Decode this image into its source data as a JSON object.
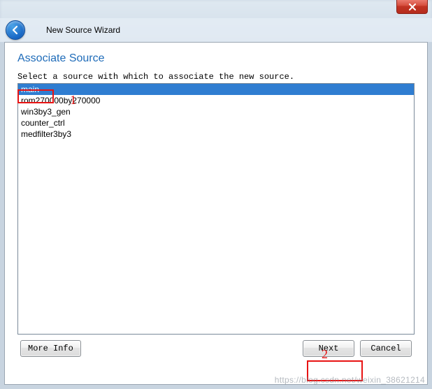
{
  "window": {
    "title": "New Source Wizard"
  },
  "panel": {
    "heading": "Associate Source",
    "instruction": "Select a source with which to associate the new source."
  },
  "source_list": {
    "items": [
      {
        "label": "main",
        "selected": true
      },
      {
        "label": "rom270000by270000",
        "selected": false
      },
      {
        "label": "win3by3_gen",
        "selected": false
      },
      {
        "label": "counter_ctrl",
        "selected": false
      },
      {
        "label": "medfilter3by3",
        "selected": false
      }
    ]
  },
  "buttons": {
    "more_info": "More Info",
    "next": "Next",
    "cancel": "Cancel"
  },
  "annotations": {
    "label1": "1",
    "label2": "2"
  },
  "watermark": "https://blog.csdn.net/weixin_38621214",
  "colors": {
    "accent_blue": "#1f6cb9",
    "selection_blue": "#2f7dd1",
    "anno_red": "#e81313"
  }
}
